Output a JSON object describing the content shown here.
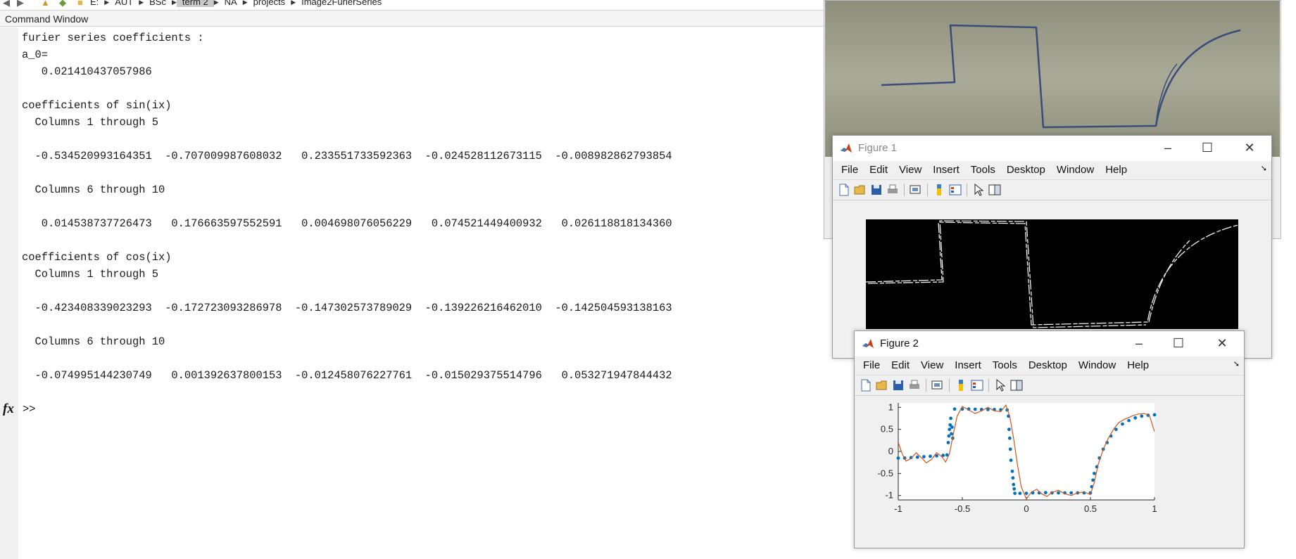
{
  "address_bar": {
    "path": [
      "E:",
      "AUT",
      "BSc",
      "term 2",
      "NA",
      "projects",
      "Image2FurierSeries"
    ],
    "selected_index": 3
  },
  "command_window": {
    "title": "Command Window",
    "output_lines": [
      "furier series coefficients :",
      "a_0=",
      "   0.021410437057986",
      "",
      "coefficients of sin(ix)",
      "  Columns 1 through 5",
      "",
      "  -0.534520993164351  -0.707009987608032   0.233551733592363  -0.024528112673115  -0.008982862793854",
      "",
      "  Columns 6 through 10",
      "",
      "   0.014538737726473   0.176663597552591   0.004698076056229   0.074521449400932   0.026118818134360",
      "",
      "coefficients of cos(ix)",
      "  Columns 1 through 5",
      "",
      "  -0.423408339023293  -0.172723093286978  -0.147302573789029  -0.139226216462010  -0.142504593138163",
      "",
      "  Columns 6 through 10",
      "",
      "  -0.074995144230749   0.001392637800153  -0.012458076227761  -0.015029375514796   0.053271947844432"
    ],
    "prompt": ">>",
    "fx_label": "fx"
  },
  "figure1": {
    "title": "Figure 1",
    "menu": [
      "File",
      "Edit",
      "View",
      "Insert",
      "Tools",
      "Desktop",
      "Window",
      "Help"
    ]
  },
  "figure2": {
    "title": "Figure 2",
    "menu": [
      "File",
      "Edit",
      "View",
      "Insert",
      "Tools",
      "Desktop",
      "Window",
      "Help"
    ]
  },
  "toolbar_icons": [
    "new-figure-icon",
    "open-file-icon",
    "save-icon",
    "print-icon",
    "link-plot-icon",
    "colorbar-icon",
    "legend-icon",
    "edit-plot-icon",
    "property-inspector-icon"
  ],
  "colors": {
    "scatter": "#0072bd",
    "fourier_line": "#d95319",
    "matlab_logo": "#c6401b"
  },
  "chart_data": {
    "type": "line",
    "title": "",
    "xlabel": "",
    "ylabel": "",
    "xlim": [
      -1,
      1
    ],
    "ylim": [
      -1.1,
      1.1
    ],
    "xticks": [
      -1,
      -0.5,
      0,
      0.5,
      1
    ],
    "xtick_labels": [
      "-1",
      "-0.5",
      "0",
      "0.5",
      "1"
    ],
    "yticks": [
      1,
      0.5,
      0,
      -0.5,
      -1
    ],
    "ytick_labels": [
      "1",
      "0.5",
      "0",
      "-0.5",
      "-1"
    ],
    "series": [
      {
        "kind": "scatter",
        "color": "#0072bd",
        "points": [
          [
            -1.0,
            -0.15
          ],
          [
            -0.95,
            -0.15
          ],
          [
            -0.9,
            -0.14
          ],
          [
            -0.85,
            -0.13
          ],
          [
            -0.8,
            -0.12
          ],
          [
            -0.75,
            -0.11
          ],
          [
            -0.7,
            -0.1
          ],
          [
            -0.65,
            -0.09
          ],
          [
            -0.62,
            -0.08
          ],
          [
            -0.61,
            0.2
          ],
          [
            -0.6,
            0.5
          ],
          [
            -0.605,
            0.35
          ],
          [
            -0.595,
            0.6
          ],
          [
            -0.59,
            0.75
          ],
          [
            -0.585,
            0.4
          ],
          [
            -0.58,
            0.55
          ],
          [
            -0.575,
            0.3
          ],
          [
            -0.56,
            0.96
          ],
          [
            -0.5,
            0.96
          ],
          [
            -0.45,
            0.96
          ],
          [
            -0.4,
            0.955
          ],
          [
            -0.35,
            0.95
          ],
          [
            -0.3,
            0.95
          ],
          [
            -0.25,
            0.95
          ],
          [
            -0.2,
            0.945
          ],
          [
            -0.15,
            0.94
          ],
          [
            -0.14,
            0.8
          ],
          [
            -0.135,
            0.5
          ],
          [
            -0.13,
            0.3
          ],
          [
            -0.125,
            0.05
          ],
          [
            -0.12,
            -0.2
          ],
          [
            -0.11,
            -0.45
          ],
          [
            -0.105,
            -0.6
          ],
          [
            -0.1,
            -0.75
          ],
          [
            -0.095,
            -0.85
          ],
          [
            -0.09,
            -0.95
          ],
          [
            -0.05,
            -0.95
          ],
          [
            0.0,
            -0.95
          ],
          [
            0.05,
            -0.94
          ],
          [
            0.1,
            -0.94
          ],
          [
            0.15,
            -0.935
          ],
          [
            0.2,
            -0.94
          ],
          [
            0.25,
            -0.94
          ],
          [
            0.3,
            -0.94
          ],
          [
            0.35,
            -0.94
          ],
          [
            0.4,
            -0.94
          ],
          [
            0.45,
            -0.94
          ],
          [
            0.5,
            -0.94
          ],
          [
            0.51,
            -0.8
          ],
          [
            0.52,
            -0.65
          ],
          [
            0.53,
            -0.5
          ],
          [
            0.55,
            -0.35
          ],
          [
            0.57,
            -0.15
          ],
          [
            0.6,
            0.05
          ],
          [
            0.63,
            0.2
          ],
          [
            0.66,
            0.35
          ],
          [
            0.7,
            0.5
          ],
          [
            0.75,
            0.62
          ],
          [
            0.8,
            0.7
          ],
          [
            0.85,
            0.76
          ],
          [
            0.9,
            0.8
          ],
          [
            0.95,
            0.82
          ],
          [
            1.0,
            0.83
          ]
        ]
      },
      {
        "kind": "line",
        "color": "#d95319",
        "points": [
          [
            -1.0,
            0.2
          ],
          [
            -0.97,
            -0.05
          ],
          [
            -0.94,
            -0.22
          ],
          [
            -0.9,
            -0.16
          ],
          [
            -0.86,
            -0.03
          ],
          [
            -0.82,
            -0.14
          ],
          [
            -0.78,
            -0.26
          ],
          [
            -0.74,
            -0.18
          ],
          [
            -0.7,
            -0.03
          ],
          [
            -0.66,
            -0.12
          ],
          [
            -0.63,
            -0.24
          ],
          [
            -0.6,
            -0.05
          ],
          [
            -0.57,
            0.4
          ],
          [
            -0.54,
            0.8
          ],
          [
            -0.5,
            1.02
          ],
          [
            -0.45,
            0.94
          ],
          [
            -0.4,
            0.86
          ],
          [
            -0.35,
            0.92
          ],
          [
            -0.3,
            1.0
          ],
          [
            -0.25,
            0.92
          ],
          [
            -0.2,
            0.9
          ],
          [
            -0.16,
            1.05
          ],
          [
            -0.13,
            0.8
          ],
          [
            -0.1,
            0.3
          ],
          [
            -0.07,
            -0.3
          ],
          [
            -0.04,
            -0.8
          ],
          [
            0.0,
            -1.08
          ],
          [
            0.04,
            -0.92
          ],
          [
            0.08,
            -0.86
          ],
          [
            0.12,
            -0.96
          ],
          [
            0.16,
            -1.02
          ],
          [
            0.2,
            -0.93
          ],
          [
            0.25,
            -0.88
          ],
          [
            0.3,
            -0.96
          ],
          [
            0.35,
            -1.0
          ],
          [
            0.4,
            -0.94
          ],
          [
            0.45,
            -0.92
          ],
          [
            0.5,
            -0.98
          ],
          [
            0.53,
            -0.7
          ],
          [
            0.56,
            -0.3
          ],
          [
            0.6,
            0.05
          ],
          [
            0.64,
            0.3
          ],
          [
            0.68,
            0.5
          ],
          [
            0.72,
            0.65
          ],
          [
            0.76,
            0.72
          ],
          [
            0.8,
            0.77
          ],
          [
            0.84,
            0.82
          ],
          [
            0.88,
            0.85
          ],
          [
            0.92,
            0.86
          ],
          [
            0.96,
            0.82
          ],
          [
            1.0,
            0.45
          ]
        ]
      }
    ]
  }
}
